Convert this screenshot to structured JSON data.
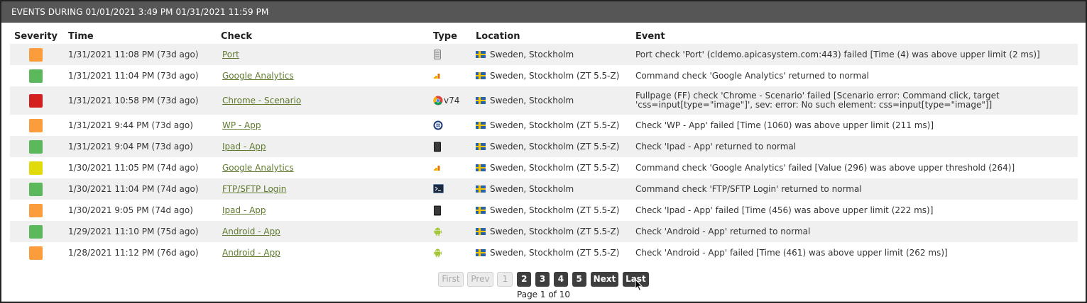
{
  "title": "EVENTS DURING 01/01/2021 3:49 PM 01/31/2021 11:59 PM",
  "columns": {
    "severity": "Severity",
    "time": "Time",
    "check": "Check",
    "type": "Type",
    "location": "Location",
    "event": "Event"
  },
  "colors": {
    "orange": "#fb9d3c",
    "green": "#5cb85c",
    "red": "#d31f1f",
    "yellow": "#e2db0b",
    "link": "#5f7a2e",
    "title_bar": "#565656"
  },
  "rows": [
    {
      "severity": "orange",
      "time": "1/31/2021 11:08 PM (73d ago)",
      "check": "Port",
      "type_icon": "server-icon",
      "type_version": "",
      "location": "Sweden, Stockholm",
      "event": "Port check 'Port' (cldemo.apicasystem.com:443) failed [Time (4) was above upper limit (2 ms)]"
    },
    {
      "severity": "green",
      "time": "1/31/2021 11:04 PM (73d ago)",
      "check": "Google Analytics",
      "type_icon": "analytics-icon",
      "type_version": "",
      "location": "Sweden, Stockholm (ZT 5.5-Z)",
      "event": "Command check 'Google Analytics' returned to normal"
    },
    {
      "severity": "red",
      "time": "1/31/2021 10:58 PM (73d ago)",
      "check": "Chrome - Scenario",
      "type_icon": "chrome-icon",
      "type_version": "v74",
      "location": "Sweden, Stockholm",
      "event": "Fullpage (FF) check 'Chrome - Scenario' failed [Scenario error: Command click, target 'css=input[type=\"image\"]', sev: error: No such element: css=input[type=\"image\"]]"
    },
    {
      "severity": "orange",
      "time": "1/31/2021 9:44 PM (73d ago)",
      "check": "WP - App",
      "type_icon": "windows-phone-icon",
      "type_version": "",
      "location": "Sweden, Stockholm (ZT 5.5-Z)",
      "event": "Check 'WP - App' failed [Time (1060) was above upper limit (211 ms)]"
    },
    {
      "severity": "green",
      "time": "1/31/2021 9:04 PM (73d ago)",
      "check": "Ipad - App",
      "type_icon": "ipad-icon",
      "type_version": "",
      "location": "Sweden, Stockholm (ZT 5.5-Z)",
      "event": "Check 'Ipad - App' returned to normal"
    },
    {
      "severity": "yellow",
      "time": "1/30/2021 11:05 PM (74d ago)",
      "check": "Google Analytics",
      "type_icon": "analytics-icon",
      "type_version": "",
      "location": "Sweden, Stockholm (ZT 5.5-Z)",
      "event": "Command check 'Google Analytics' failed [Value (296) was above upper threshold (264)]"
    },
    {
      "severity": "green",
      "time": "1/30/2021 11:04 PM (74d ago)",
      "check": "FTP/SFTP Login",
      "type_icon": "terminal-icon",
      "type_version": "",
      "location": "Sweden, Stockholm",
      "event": "Command check 'FTP/SFTP Login' returned to normal"
    },
    {
      "severity": "orange",
      "time": "1/30/2021 9:05 PM (74d ago)",
      "check": "Ipad - App",
      "type_icon": "ipad-icon",
      "type_version": "",
      "location": "Sweden, Stockholm (ZT 5.5-Z)",
      "event": "Check 'Ipad - App' failed [Time (456) was above upper limit (222 ms)]"
    },
    {
      "severity": "green",
      "time": "1/29/2021 11:10 PM (75d ago)",
      "check": "Android - App",
      "type_icon": "android-icon",
      "type_version": "",
      "location": "Sweden, Stockholm (ZT 5.5-Z)",
      "event": "Check 'Android - App' returned to normal"
    },
    {
      "severity": "orange",
      "time": "1/28/2021 11:12 PM (76d ago)",
      "check": "Android - App",
      "type_icon": "android-icon",
      "type_version": "",
      "location": "Sweden, Stockholm (ZT 5.5-Z)",
      "event": "Check 'Android - App' failed [Time (461) was above upper limit (262 ms)]"
    }
  ],
  "pagination": {
    "first": "First",
    "prev": "Prev",
    "pages": [
      "1",
      "2",
      "3",
      "4",
      "5"
    ],
    "current": "1",
    "next": "Next",
    "last": "Last",
    "info": "Page 1 of 10"
  }
}
